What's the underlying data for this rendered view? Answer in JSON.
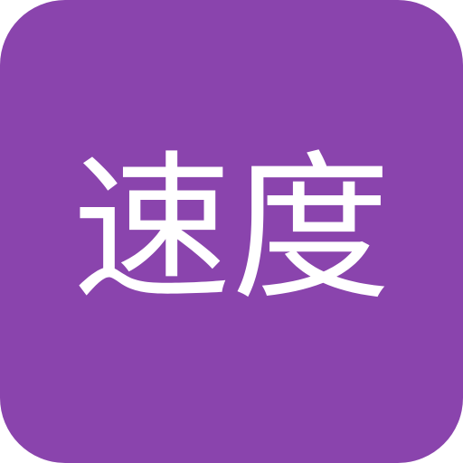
{
  "icon": {
    "label": "速度",
    "background_color": "#8a44ad",
    "text_color": "#ffffff"
  }
}
